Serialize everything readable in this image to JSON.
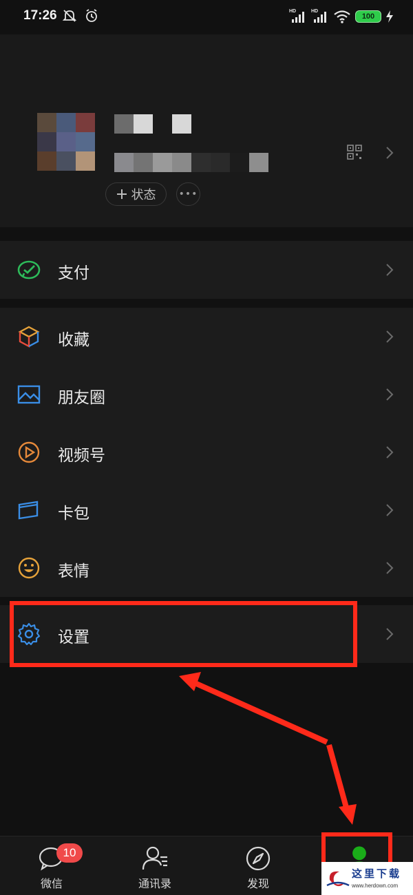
{
  "status_bar": {
    "time": "17:26",
    "hd_1": "HD",
    "hd_2": "HD",
    "battery": "100"
  },
  "profile": {
    "status_button": "状态",
    "status_button_icon": "plus-icon",
    "more_button_icon": "ellipsis-icon",
    "qr_icon": "qr-code-icon"
  },
  "menu": {
    "pay": {
      "label": "支付",
      "icon": "wechat-pay-icon",
      "color": "#2dbb5a"
    },
    "items": [
      {
        "label": "收藏",
        "icon": "cube-icon"
      },
      {
        "label": "朋友圈",
        "icon": "image-icon",
        "color": "#3a8ee6"
      },
      {
        "label": "视频号",
        "icon": "play-circle-icon",
        "color": "#e6893a"
      },
      {
        "label": "卡包",
        "icon": "card-icon",
        "color": "#3a8ee6"
      },
      {
        "label": "表情",
        "icon": "smile-icon",
        "color": "#e6a23a"
      }
    ],
    "settings": {
      "label": "设置",
      "icon": "gear-icon",
      "color": "#3a8ee6"
    }
  },
  "tabbar": {
    "tabs": [
      {
        "label": "微信",
        "icon": "chat-bubble-icon",
        "badge": "10"
      },
      {
        "label": "通讯录",
        "icon": "contacts-icon"
      },
      {
        "label": "发现",
        "icon": "compass-icon"
      },
      {
        "label": "",
        "icon": "person-icon",
        "active": true
      }
    ],
    "active_color": "#1aad19"
  },
  "annotation": {
    "highlight_color": "#ff2a1a"
  },
  "watermark": {
    "text": "这里下载",
    "url": "www.herdown.com"
  }
}
